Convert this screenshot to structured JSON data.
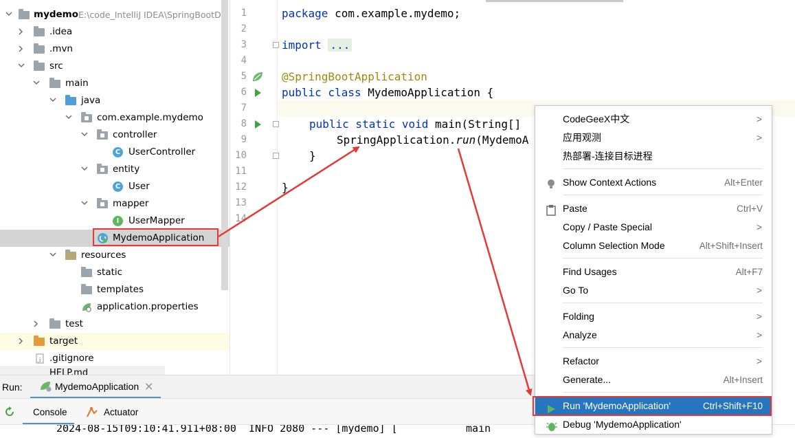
{
  "tree": {
    "root_name": "mydemo",
    "root_path": "E:\\code_IntelliJ IDEA\\SpringBootDe",
    "items": [
      {
        "label": ".idea"
      },
      {
        "label": ".mvn"
      },
      {
        "label": "src"
      },
      {
        "label": "main"
      },
      {
        "label": "java"
      },
      {
        "label": "com.example.mydemo"
      },
      {
        "label": "controller"
      },
      {
        "label": "UserController",
        "icon": "C"
      },
      {
        "label": "entity"
      },
      {
        "label": "User",
        "icon": "C"
      },
      {
        "label": "mapper"
      },
      {
        "label": "UserMapper",
        "icon": "I"
      },
      {
        "label": "MydemoApplication"
      },
      {
        "label": "resources"
      },
      {
        "label": "static"
      },
      {
        "label": "templates"
      },
      {
        "label": "application.properties"
      },
      {
        "label": "test"
      },
      {
        "label": "target"
      },
      {
        "label": ".gitignore"
      },
      {
        "label": "HELP.md"
      }
    ]
  },
  "editor": {
    "line_numbers": [
      "1",
      "2",
      "3",
      "4",
      "5",
      "6",
      "7",
      "8",
      "9",
      "10",
      "11",
      "12",
      "13",
      "14"
    ],
    "code": {
      "l1_kw": "package",
      "l1_rest": " com.example.mydemo;",
      "l3_kw": "import",
      "l3_fold": "...",
      "l6_ann": "@SpringBootApplication",
      "l7_kw": "public class",
      "l7_rest": " MydemoApplication {",
      "l9_kw": "public static void",
      "l9_rest": " main(String[]",
      "l10_a": "SpringApplication.",
      "l10_b": "run",
      "l10_c": "(MydemoA",
      "l11": "}",
      "l13": "}"
    }
  },
  "context_menu": {
    "items": [
      {
        "label": "CodeGeeX中文",
        "shortcut": "",
        "submenu": true
      },
      {
        "label": "应用观测",
        "shortcut": "",
        "submenu": true
      },
      {
        "label": "热部署-连接目标进程",
        "shortcut": "",
        "submenu": false
      },
      {
        "label": "Show Context Actions",
        "shortcut": "Alt+Enter",
        "submenu": false
      },
      {
        "label": "Paste",
        "shortcut": "Ctrl+V",
        "submenu": false
      },
      {
        "label": "Copy / Paste Special",
        "shortcut": "",
        "submenu": true
      },
      {
        "label": "Column Selection Mode",
        "shortcut": "Alt+Shift+Insert",
        "submenu": false
      },
      {
        "label": "Find Usages",
        "shortcut": "Alt+F7",
        "submenu": false
      },
      {
        "label": "Go To",
        "shortcut": "",
        "submenu": true
      },
      {
        "label": "Folding",
        "shortcut": "",
        "submenu": true
      },
      {
        "label": "Analyze",
        "shortcut": "",
        "submenu": true
      },
      {
        "label": "Refactor",
        "shortcut": "",
        "submenu": true
      },
      {
        "label": "Generate...",
        "shortcut": "Alt+Insert",
        "submenu": false
      },
      {
        "label": "Run 'MydemoApplication'",
        "shortcut": "Ctrl+Shift+F10",
        "submenu": false
      },
      {
        "label": "Debug 'MydemoApplication'",
        "shortcut": "",
        "submenu": false
      }
    ],
    "submenu_glyph": ">"
  },
  "run_panel": {
    "run_label": "Run:",
    "run_tab": "MydemoApplication",
    "close_glyph": "×",
    "console_tab": "Console",
    "actuator_tab": "Actuator",
    "log_line": "2024-08-15T09:10:41.911+08:00  INFO 2080 --- [mydemo] [           main"
  },
  "colors": {
    "accent": "#2675bf",
    "annotation_red": "#e53935",
    "run_green": "#45a346",
    "keyword": "#0033b3"
  }
}
